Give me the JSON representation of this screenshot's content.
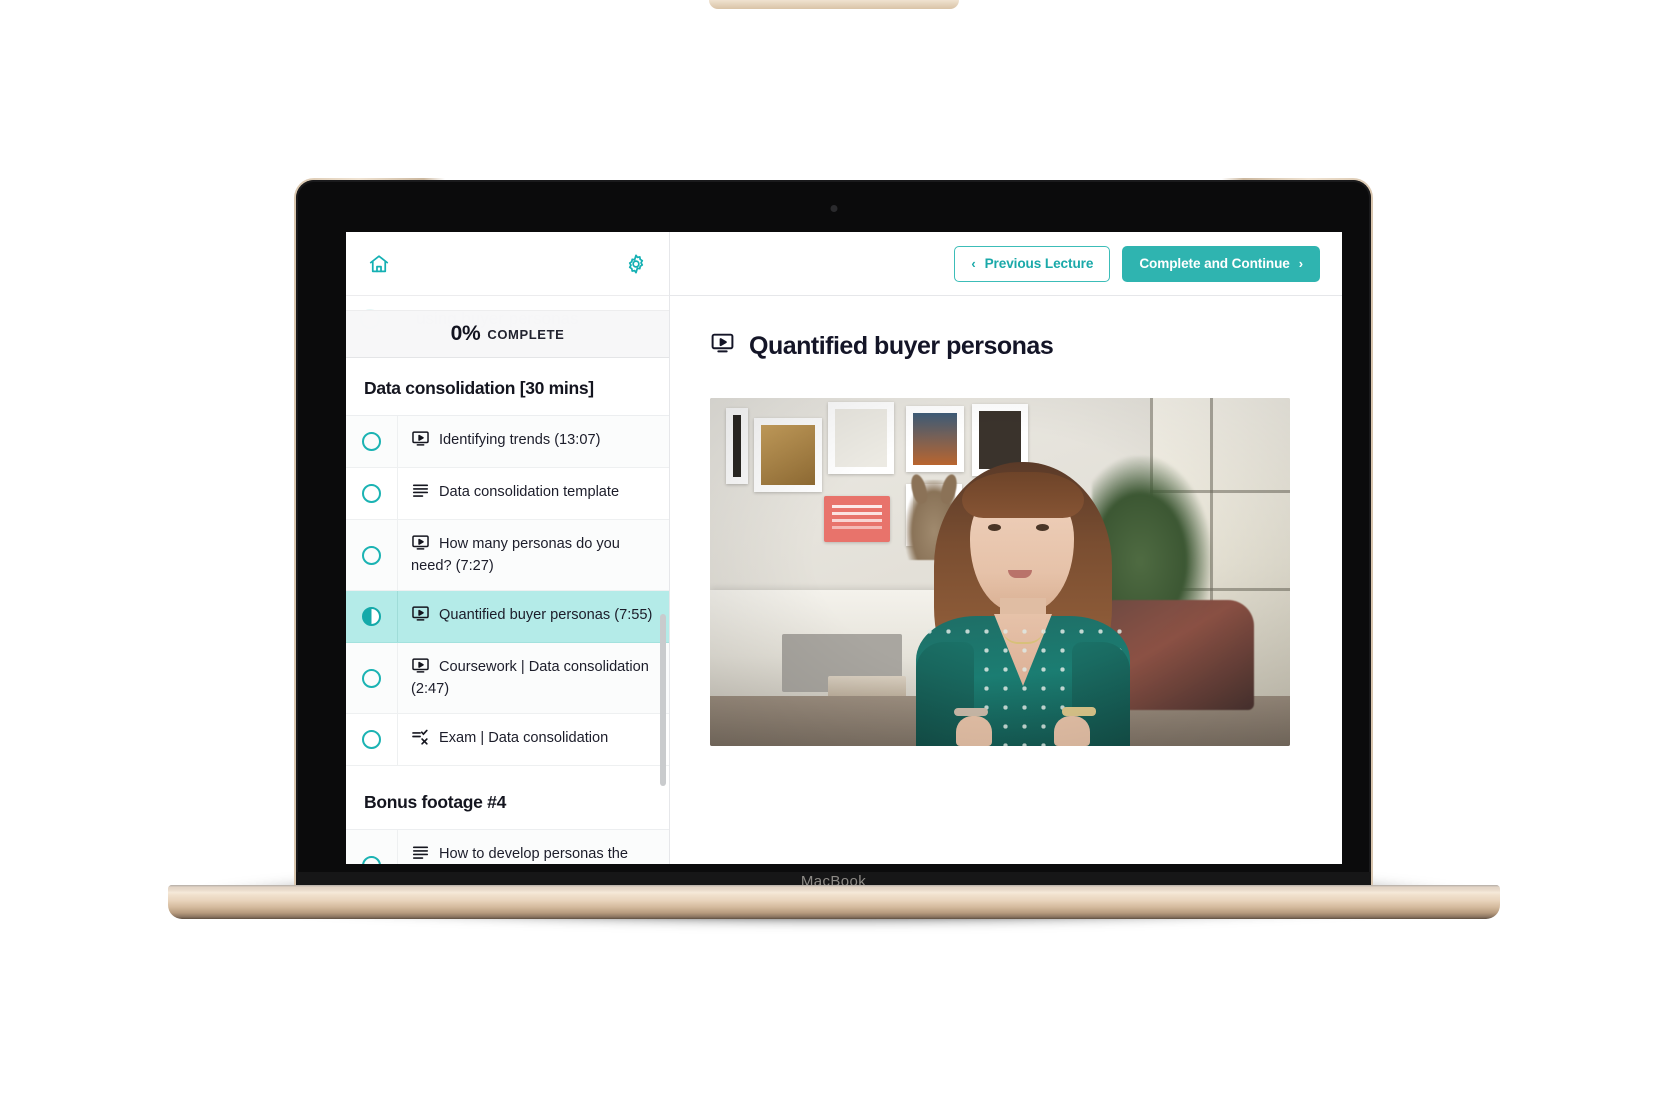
{
  "device": {
    "brand_label": "MacBook"
  },
  "sidebar": {
    "home_icon": "home-icon",
    "settings_icon": "gear-icon",
    "ghost_row_text": "using buyer personas",
    "progress": {
      "percent": "0%",
      "label": "COMPLETE"
    },
    "sections": [
      {
        "title": "Data consolidation [30 mins]",
        "lessons": [
          {
            "title": "Identifying trends (13:07)",
            "icon": "video-icon",
            "state": "incomplete"
          },
          {
            "title": "Data consolidation template",
            "icon": "text-icon",
            "state": "incomplete"
          },
          {
            "title": "How many personas do you need? (7:27)",
            "icon": "video-icon",
            "state": "incomplete"
          },
          {
            "title": "Quantified buyer personas (7:55)",
            "icon": "video-icon",
            "state": "in-progress"
          },
          {
            "title": "Coursework | Data consolidation (2:47)",
            "icon": "video-icon",
            "state": "incomplete"
          },
          {
            "title": "Exam | Data consolidation",
            "icon": "quiz-icon",
            "state": "incomplete"
          }
        ]
      },
      {
        "title": "Bonus footage #4",
        "lessons": [
          {
            "title": "How to develop personas the right way",
            "icon": "text-icon",
            "state": "incomplete"
          }
        ]
      }
    ]
  },
  "main": {
    "previous_button": {
      "label": "Previous Lecture",
      "chevron": "‹"
    },
    "continue_button": {
      "label": "Complete and Continue",
      "chevron": "›"
    },
    "lecture": {
      "title": "Quantified buyer personas",
      "icon": "video-icon"
    }
  },
  "colors": {
    "accent_teal": "#2fb4b0",
    "accent_teal_dark": "#1aa9a9",
    "active_row": "#b4ebe8",
    "text_dark": "#141527"
  }
}
